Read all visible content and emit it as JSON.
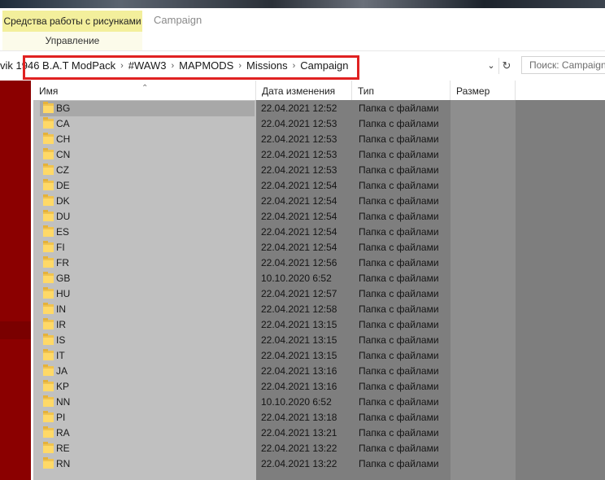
{
  "ribbon": {
    "context_tab": "Средства работы с рисунками",
    "context_group": "Управление",
    "window_title": "Campaign"
  },
  "address": {
    "crumbs": [
      "vik 1946 B.A.T ModPack",
      "#WAW3",
      "MAPMODS",
      "Missions",
      "Campaign"
    ],
    "search_placeholder": "Поиск: Campaign"
  },
  "columns": {
    "name": "Имя",
    "date": "Дата изменения",
    "type": "Тип",
    "size": "Размер"
  },
  "rows": [
    {
      "name": "BG",
      "date": "22.04.2021 12:52",
      "type": "Папка с файлами"
    },
    {
      "name": "CA",
      "date": "22.04.2021 12:53",
      "type": "Папка с файлами"
    },
    {
      "name": "CH",
      "date": "22.04.2021 12:53",
      "type": "Папка с файлами"
    },
    {
      "name": "CN",
      "date": "22.04.2021 12:53",
      "type": "Папка с файлами"
    },
    {
      "name": "CZ",
      "date": "22.04.2021 12:53",
      "type": "Папка с файлами"
    },
    {
      "name": "DE",
      "date": "22.04.2021 12:54",
      "type": "Папка с файлами"
    },
    {
      "name": "DK",
      "date": "22.04.2021 12:54",
      "type": "Папка с файлами"
    },
    {
      "name": "DU",
      "date": "22.04.2021 12:54",
      "type": "Папка с файлами"
    },
    {
      "name": "ES",
      "date": "22.04.2021 12:54",
      "type": "Папка с файлами"
    },
    {
      "name": "FI",
      "date": "22.04.2021 12:54",
      "type": "Папка с файлами"
    },
    {
      "name": "FR",
      "date": "22.04.2021 12:56",
      "type": "Папка с файлами"
    },
    {
      "name": "GB",
      "date": "10.10.2020 6:52",
      "type": "Папка с файлами"
    },
    {
      "name": "HU",
      "date": "22.04.2021 12:57",
      "type": "Папка с файлами"
    },
    {
      "name": "IN",
      "date": "22.04.2021 12:58",
      "type": "Папка с файлами"
    },
    {
      "name": "IR",
      "date": "22.04.2021 13:15",
      "type": "Папка с файлами"
    },
    {
      "name": "IS",
      "date": "22.04.2021 13:15",
      "type": "Папка с файлами"
    },
    {
      "name": "IT",
      "date": "22.04.2021 13:15",
      "type": "Папка с файлами"
    },
    {
      "name": "JA",
      "date": "22.04.2021 13:16",
      "type": "Папка с файлами"
    },
    {
      "name": "KP",
      "date": "22.04.2021 13:16",
      "type": "Папка с файлами"
    },
    {
      "name": "NN",
      "date": "10.10.2020 6:52",
      "type": "Папка с файлами"
    },
    {
      "name": "PI",
      "date": "22.04.2021 13:18",
      "type": "Папка с файлами"
    },
    {
      "name": "RA",
      "date": "22.04.2021 13:21",
      "type": "Папка с файлами"
    },
    {
      "name": "RE",
      "date": "22.04.2021 13:22",
      "type": "Папка с файлами"
    },
    {
      "name": "RN",
      "date": "22.04.2021 13:22",
      "type": "Папка с файлами"
    }
  ],
  "colors": {
    "highlight_border": "#e02222",
    "context_tab_bg": "#f3ef9c",
    "nav_pane_bg": "#8b0000",
    "folder_icon": "#ffd967"
  },
  "icons": {
    "dropdown": "chevron-down-icon",
    "refresh": "refresh-icon",
    "folder": "folder-icon",
    "sort": "sort-up-icon"
  }
}
